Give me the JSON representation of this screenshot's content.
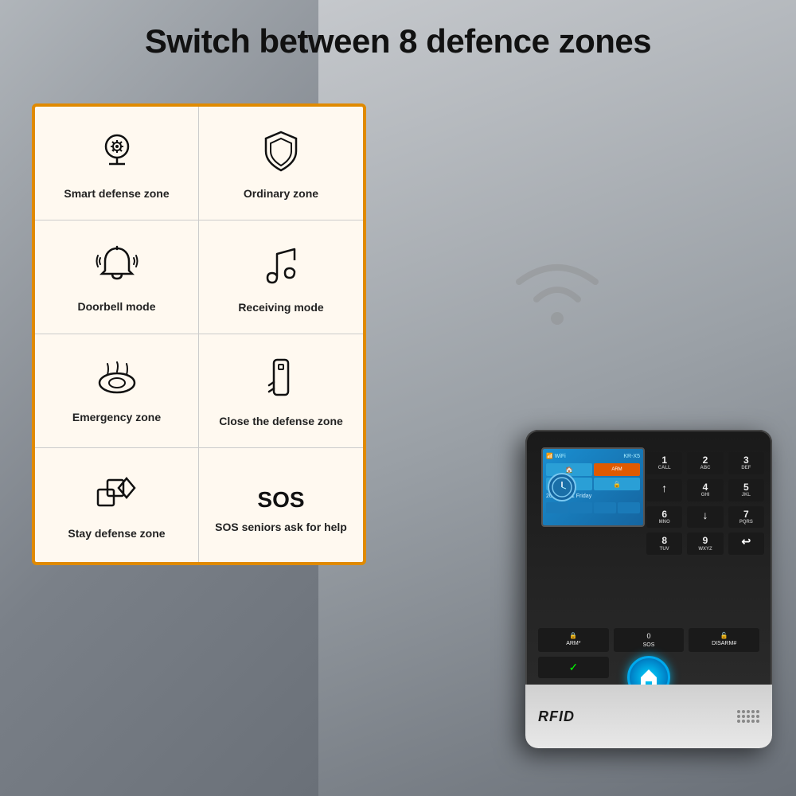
{
  "title": "Switch between 8 defence zones",
  "features": [
    {
      "id": "smart-defense",
      "icon": "🧠⚙️",
      "icon_type": "head-gear",
      "label": "Smart defense zone"
    },
    {
      "id": "ordinary-zone",
      "icon": "🛡",
      "icon_type": "shield",
      "label": "Ordinary zone"
    },
    {
      "id": "doorbell-mode",
      "icon": "🔔",
      "icon_type": "bell",
      "label": "Doorbell mode"
    },
    {
      "id": "receiving-mode",
      "icon": "♪",
      "icon_type": "music-note",
      "label": "Receiving mode"
    },
    {
      "id": "emergency-zone",
      "icon": "💨",
      "icon_type": "smoke-detector",
      "label": "Emergency zone"
    },
    {
      "id": "close-defense",
      "icon": "🔑",
      "icon_type": "key",
      "label": "Close the defense zone"
    },
    {
      "id": "stay-defense",
      "icon": "⬜◇",
      "icon_type": "shapes",
      "label": "Stay defense zone"
    },
    {
      "id": "sos-seniors",
      "icon": "SOS",
      "icon_type": "sos-text",
      "label": "SOS seniors ask for help"
    }
  ],
  "device": {
    "rfid_label": "RFID",
    "keypad": [
      {
        "main": "1",
        "sub": "CALL"
      },
      {
        "main": "2",
        "sub": "ABC"
      },
      {
        "main": "3",
        "sub": "DEF"
      },
      {
        "main": "4",
        "sub": "GHI"
      },
      {
        "main": "5",
        "sub": "JKL"
      },
      {
        "main": "6",
        "sub": "MNO"
      },
      {
        "main": "7",
        "sub": "PQRS"
      },
      {
        "main": "8",
        "sub": "TUV"
      },
      {
        "main": "9",
        "sub": "WXYZ"
      },
      {
        "main": "*",
        "sub": "ARM*"
      },
      {
        "main": "0",
        "sub": "SOS"
      },
      {
        "main": "#",
        "sub": "DISARM#"
      }
    ],
    "arrows": [
      "↑",
      "↓",
      "↩"
    ]
  }
}
